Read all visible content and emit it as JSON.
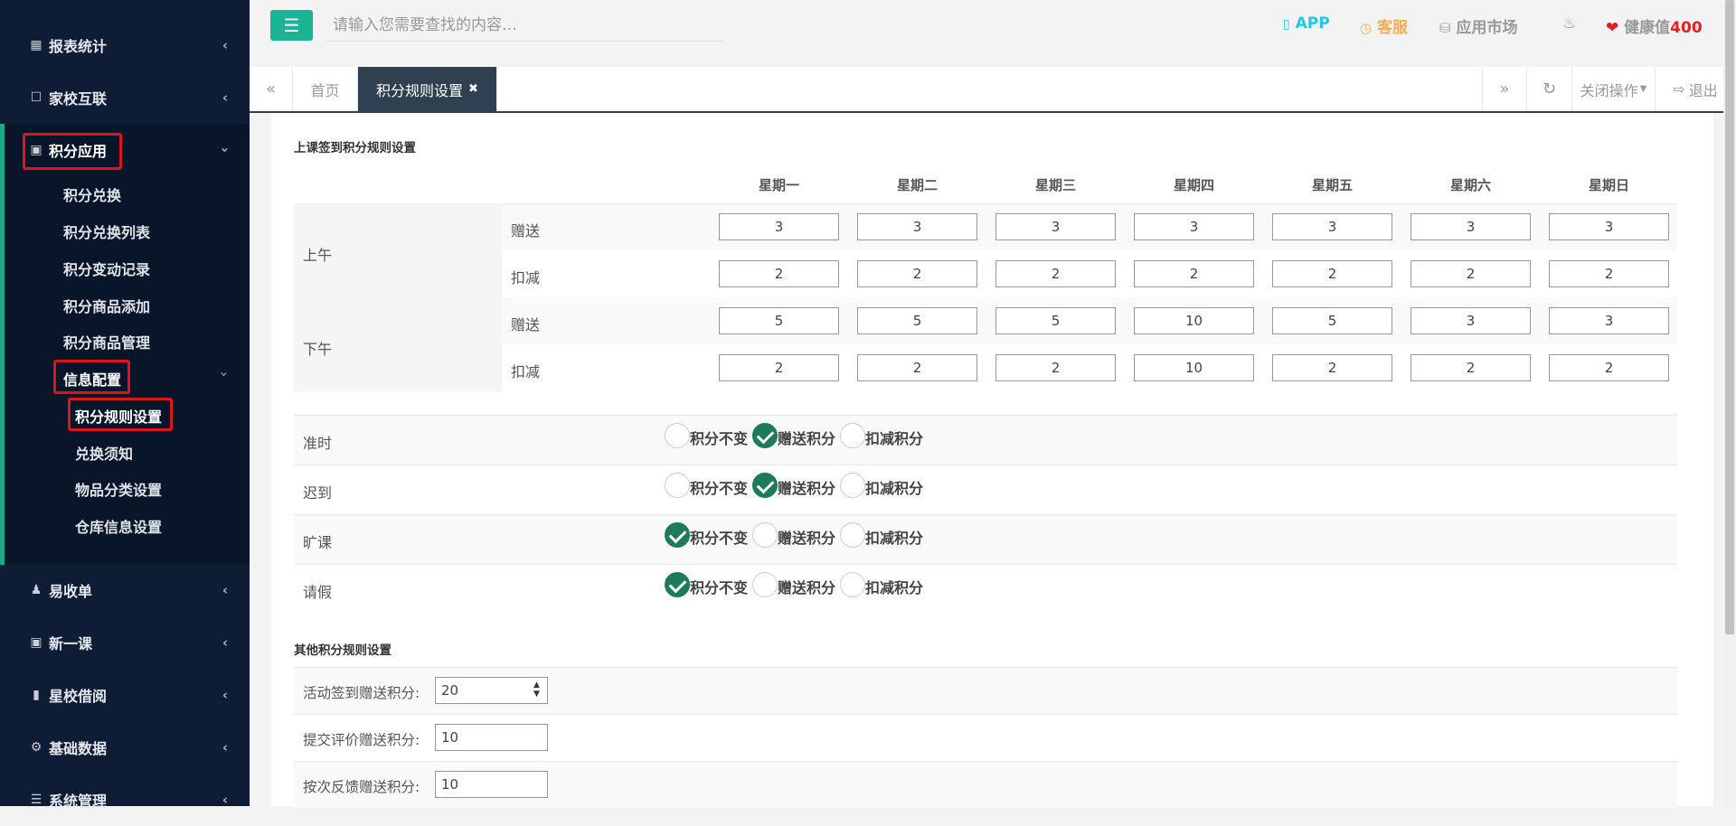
{
  "sidebar": {
    "items": [
      {
        "label": "报表统计",
        "icon": "bar-chart-icon"
      },
      {
        "label": "家校互联",
        "icon": "chat-icon"
      },
      {
        "label": "积分应用",
        "icon": "inbox-icon"
      },
      {
        "label": "易收单",
        "icon": "user-plus-icon"
      },
      {
        "label": "新一课",
        "icon": "inbox-icon"
      },
      {
        "label": "星校借阅",
        "icon": "book-icon"
      },
      {
        "label": "基础数据",
        "icon": "gear-icon"
      },
      {
        "label": "系统管理",
        "icon": "list-icon"
      }
    ],
    "sub_items": [
      "积分兑换",
      "积分兑换列表",
      "积分变动记录",
      "积分商品添加",
      "积分商品管理"
    ],
    "info_config": "信息配置",
    "info_sub": [
      "积分规则设置",
      "兑换须知",
      "物品分类设置",
      "仓库信息设置"
    ]
  },
  "topbar": {
    "search_placeholder": "请输入您需要查找的内容…",
    "app": "APP",
    "service": "客服",
    "market": "应用市场",
    "health_label": "健康值",
    "health_value": "400"
  },
  "tabs": {
    "home": "首页",
    "active": "积分规则设置",
    "close_ops": "关闭操作",
    "logout": "退出"
  },
  "checkin": {
    "title": "上课签到积分规则设置",
    "days": [
      "星期一",
      "星期二",
      "星期三",
      "星期四",
      "星期五",
      "星期六",
      "星期日"
    ],
    "morning": "上午",
    "afternoon": "下午",
    "give": "赠送",
    "deduct": "扣减",
    "morning_give": [
      "3",
      "3",
      "3",
      "3",
      "3",
      "3",
      "3"
    ],
    "morning_deduct": [
      "2",
      "2",
      "2",
      "2",
      "2",
      "2",
      "2"
    ],
    "afternoon_give": [
      "5",
      "5",
      "5",
      "10",
      "5",
      "3",
      "3"
    ],
    "afternoon_deduct": [
      "2",
      "2",
      "2",
      "10",
      "2",
      "2",
      "2"
    ]
  },
  "status_rules": {
    "options": [
      "积分不变",
      "赠送积分",
      "扣减积分"
    ],
    "rows": [
      {
        "label": "准时",
        "selected": 1
      },
      {
        "label": "迟到",
        "selected": 1
      },
      {
        "label": "旷课",
        "selected": 0
      },
      {
        "label": "请假",
        "selected": 0
      }
    ]
  },
  "other": {
    "title": "其他积分规则设置",
    "rows": [
      {
        "label": "活动签到赠送积分:",
        "value": "20"
      },
      {
        "label": "提交评价赠送积分:",
        "value": "10"
      },
      {
        "label": "按次反馈赠送积分:",
        "value": "10"
      }
    ]
  },
  "colors": {
    "sidebar_bg": "#0e1d35",
    "accent": "#1ab394",
    "check": "#1d7b5c",
    "highlight": "#e0151b",
    "app": "#23c6e8",
    "service": "#f8ac59",
    "health": "#ed1c24"
  }
}
